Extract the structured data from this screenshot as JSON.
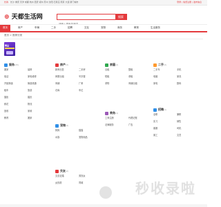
{
  "topbar": {
    "city": "长春",
    "links": "长沙 重庆 天津 成都 杭州 西安 郑州 苏州 沈阳 石家庄 南京 大连 厦门城市",
    "right": "登录 | 免费注册 | 发布信息"
  },
  "logo": {
    "prefix": "天都",
    "name": "天都生活网"
  },
  "search": {
    "placeholder": "请输入搜索关键词",
    "button": "搜索"
  },
  "nav": {
    "items": [
      "首页",
      "房产",
      "车辆",
      "二手",
      "招聘",
      "交友",
      "宠物",
      "商务",
      "教育",
      "生活服务"
    ]
  },
  "breadcrumb": "首页 > 推荐分类",
  "featured": {
    "title": "精品",
    "subtitle": "广告"
  },
  "categories": [
    {
      "name": "服务",
      "count": "(45)",
      "color": "#2f8fe8",
      "items": [
        "搬家",
        "装修",
        "保洁",
        "家电维修",
        "开锁换锁",
        "管道疏通",
        "租车",
        "旅游",
        "摄影",
        "婚庆",
        "鲜花",
        "物流",
        "回收",
        "家政",
        "教育",
        "搬家"
      ]
    },
    {
      "name": "房产",
      "count": "(3)",
      "color": "#e4393c",
      "items": [
        "新房出售",
        "二手房",
        "房屋出租",
        "写字楼",
        "商铺",
        "厂房",
        "仓库",
        "车位"
      ]
    },
    {
      "name": "房屋",
      "count": "(2)",
      "color": "#2fa84f",
      "items": [
        "合租",
        "整租",
        "短租",
        "求租",
        "求购",
        "商铺出租"
      ]
    },
    {
      "name": "二手",
      "count": "(3)",
      "color": "#ff9a2e",
      "items": [
        "二手车",
        "手机",
        "电脑",
        "家具",
        "家电",
        "数码"
      ]
    },
    {
      "name": "招聘",
      "count": "(1)",
      "color": "#2f8fe8",
      "items": [
        "全职",
        "兼职",
        "实习",
        "销售",
        "客服",
        "司机",
        "普工",
        "文员"
      ]
    },
    {
      "name": "宠物",
      "count": "(4)",
      "color": "#2f8fe8",
      "items": [
        "狗狗",
        "猫猫",
        "水族",
        "宠物用品"
      ]
    },
    {
      "name": "交友",
      "count": "(2)",
      "color": "#e4393c",
      "items": [
        "交友征婚",
        "男找女",
        "女找男",
        "同城"
      ]
    },
    {
      "name": "商务",
      "count": "(1)",
      "color": "#9b59b6",
      "items": [
        "工商注册",
        "代理记账",
        "法律服务",
        "广告"
      ]
    }
  ],
  "watermark": "秒收录啦"
}
